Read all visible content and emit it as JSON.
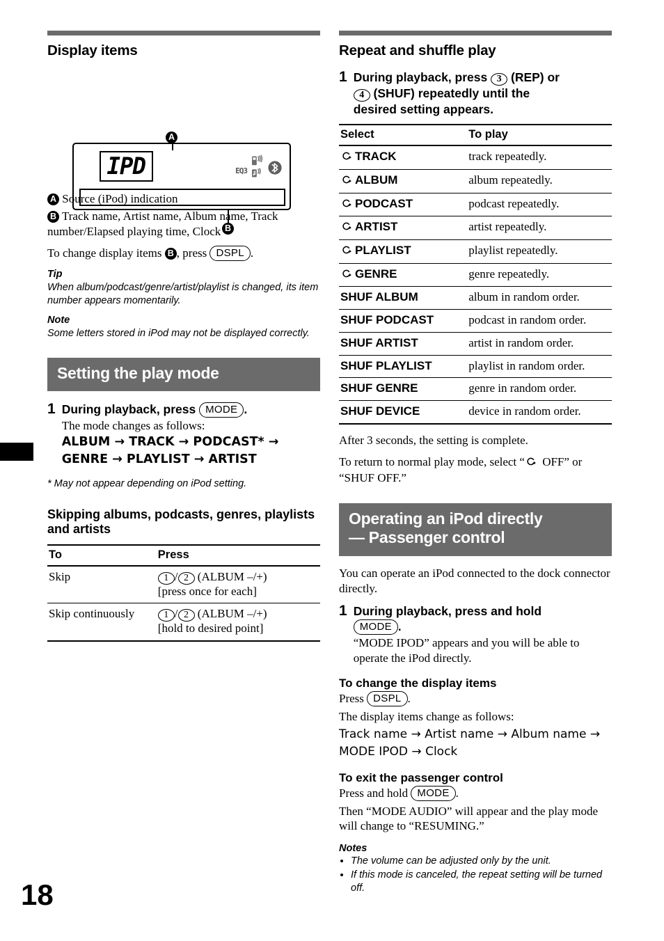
{
  "page_number": "18",
  "left_column": {
    "heading": "Display items",
    "figure": {
      "badge_a": "A",
      "badge_b": "B",
      "lcd_source_text": "IPD",
      "eq_indicator": "EQ3"
    },
    "callouts": [
      {
        "badge": "A",
        "text": "Source (iPod) indication"
      },
      {
        "badge": "B",
        "text": "Track name, Artist name, Album name, Track number/Elapsed playing time, Clock"
      }
    ],
    "change_items": {
      "prefix": "To change display items ",
      "badge": "B",
      "middle": ", press ",
      "key": "DSPL",
      "suffix": "."
    },
    "tip": {
      "label": "Tip",
      "text": "When album/podcast/genre/artist/playlist is changed, its item number appears momentarily."
    },
    "note": {
      "label": "Note",
      "text": "Some letters stored in iPod may not be displayed correctly."
    },
    "play_mode": {
      "band_title": "Setting the play mode",
      "step_number": "1",
      "step_head_prefix": "During playback, press ",
      "step_head_key": "MODE",
      "step_head_suffix": ".",
      "step_sub": "The mode changes as follows:",
      "flow_line1": "ALBUM → TRACK → PODCAST* →",
      "flow_line2": "GENRE → PLAYLIST → ARTIST",
      "footnote": "* May not appear depending on iPod setting."
    },
    "skipping": {
      "heading": "Skipping albums, podcasts, genres, playlists and artists",
      "columns": [
        "To",
        "Press"
      ],
      "rows": [
        {
          "to": "Skip",
          "keys": [
            "1",
            "2"
          ],
          "press_label": "(ALBUM –/+)",
          "press_detail": "[press once for each]"
        },
        {
          "to": "Skip continuously",
          "keys": [
            "1",
            "2"
          ],
          "press_label": "(ALBUM –/+)",
          "press_detail": "[hold to desired point]"
        }
      ]
    }
  },
  "right_column": {
    "heading": "Repeat and shuffle play",
    "step": {
      "number": "1",
      "line1_a": "During playback, press ",
      "key_rep": "3",
      "line1_b": " (REP) or",
      "line2_key": "4",
      "line2_b": " (SHUF) repeatedly until the",
      "line3": "desired setting appears."
    },
    "table": {
      "columns": [
        "Select",
        "To play"
      ],
      "rows": [
        {
          "icon": "repeat-icon",
          "select": "TRACK",
          "play": "track repeatedly."
        },
        {
          "icon": "repeat-icon",
          "select": "ALBUM",
          "play": "album repeatedly."
        },
        {
          "icon": "repeat-icon",
          "select": "PODCAST",
          "play": "podcast repeatedly."
        },
        {
          "icon": "repeat-icon",
          "select": "ARTIST",
          "play": "artist repeatedly."
        },
        {
          "icon": "repeat-icon",
          "select": "PLAYLIST",
          "play": "playlist repeatedly."
        },
        {
          "icon": "repeat-icon",
          "select": "GENRE",
          "play": "genre repeatedly."
        },
        {
          "icon": "",
          "select": "SHUF ALBUM",
          "play": "album in random order."
        },
        {
          "icon": "",
          "select": "SHUF PODCAST",
          "play": "podcast in random order."
        },
        {
          "icon": "",
          "select": "SHUF ARTIST",
          "play": "artist in random order."
        },
        {
          "icon": "",
          "select": "SHUF PLAYLIST",
          "play": "playlist in random order."
        },
        {
          "icon": "",
          "select": "SHUF GENRE",
          "play": "genre in random order."
        },
        {
          "icon": "",
          "select": "SHUF DEVICE",
          "play": "device in random order."
        }
      ]
    },
    "after_table_1": "After 3 seconds, the setting is complete.",
    "after_table_2_a": "To return to normal play mode, select “",
    "after_table_2_b": " OFF” or “SHUF OFF.”",
    "passenger": {
      "band_line1": "Operating an iPod directly",
      "band_line2": "— Passenger control",
      "intro": "You can operate an iPod connected to the dock connector directly.",
      "step_number": "1",
      "step_head": "During playback, press and hold",
      "step_key": "MODE",
      "step_key_suffix": ".",
      "step_sub": "“MODE IPOD” appears and you will be able to operate the iPod directly.",
      "display_items": {
        "heading": "To change the display items",
        "press_prefix": "Press ",
        "press_key": "DSPL",
        "press_suffix": ".",
        "line2": "The display items change as follows:",
        "flow1": "Track name → Artist name → Album name →",
        "flow2": "MODE IPOD → Clock"
      },
      "exit": {
        "heading": "To exit the passenger control",
        "press_prefix": "Press and hold ",
        "press_key": "MODE",
        "press_suffix": ".",
        "line2": "Then “MODE AUDIO” will appear and the play mode will change to “RESUMING.”"
      },
      "notes": {
        "label": "Notes",
        "items": [
          "The volume can be adjusted only by the unit.",
          "If this mode is canceled, the repeat setting will be turned off."
        ]
      }
    }
  },
  "colors": {
    "band_grey": "#6b6b6b",
    "text_black": "#000000"
  }
}
